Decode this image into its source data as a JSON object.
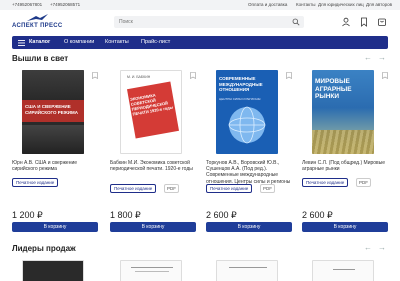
{
  "topbar": {
    "phone1": "+74952067801",
    "phone2": "+74952068571",
    "link_payment": "Оплата и доставка",
    "link_contacts": "Контакты",
    "link_legal": "Для юридических лиц",
    "link_authors": "Для авторов"
  },
  "header": {
    "logo_text": "АСПЕКТ ПРЕСС",
    "search_placeholder": "Поиск"
  },
  "nav": {
    "catalog": "Каталог",
    "about": "О компании",
    "contacts": "Контакты",
    "pricelist": "Прайс-лист"
  },
  "section_new": {
    "title": "Вышли в свет"
  },
  "section_leaders": {
    "title": "Лидеры продаж"
  },
  "books": [
    {
      "title": "Юрн А.В. США и свержение сирийского режима",
      "badge": "Печатное издание",
      "price": "1 200 ₽",
      "button": "В корзину",
      "cover_text": "США И СВЕРЖЕНИЕ СИРИЙСКОГО РЕЖИМА",
      "cover_color": "#2a2a2a"
    },
    {
      "title": "Бабкин М.И. Экономика советской периодической печати. 1920-е годы",
      "badge": "Печатное издание",
      "pdf": "PDF",
      "price": "1 800 ₽",
      "button": "В корзину",
      "cover_text": "ЭКОНОМИКА СОВЕТСКОЙ ПЕРИОДИЧЕСКОЙ ПЕЧАТИ 1920-е годы",
      "cover_author": "М. И. БАБКИН",
      "cover_color": "#ffffff"
    },
    {
      "title": "Торкунов А.В., Воровский Ю.В., Сушенцов А.А. (Под ред.). Современные международные отношения. Центры силы и регионы",
      "badge": "Печатное издание",
      "pdf": "PDF",
      "price": "2 600 ₽",
      "button": "В корзину",
      "cover_text": "СОВРЕМЕННЫЕ МЕЖДУНАРОДНЫЕ ОТНОШЕНИЯ",
      "cover_sub": "ЦЕНТРЫ СИЛЫ И РЕГИОНЫ",
      "cover_color": "#1a5fb4"
    },
    {
      "title": "Левин С.Л. (Под общред.) Мировые аграрные рынки",
      "badge": "Печатное издание",
      "pdf": "PDF",
      "price": "2 600 ₽",
      "button": "В корзину",
      "cover_text": "МИРОВЫЕ АГРАРНЫЕ РЫНКИ",
      "cover_color": "#2b6cb0"
    }
  ],
  "colors": {
    "brand": "#1f2e8a",
    "button": "#1f3d99",
    "topbar_bg": "#f2f3f5"
  }
}
